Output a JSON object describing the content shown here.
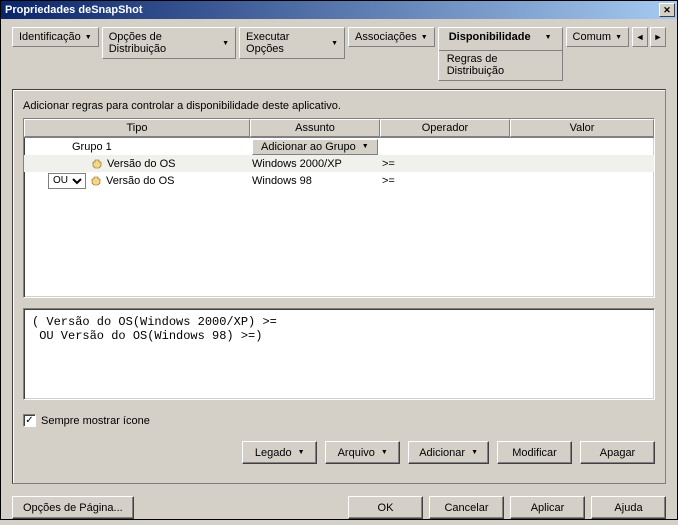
{
  "title": "Propriedades deSnapShot",
  "tabs": {
    "identificacao": "Identificação",
    "opcoes_dist": "Opções de Distribuição",
    "executar": "Executar Opções",
    "associacoes": "Associações",
    "disponibilidade": "Disponibilidade",
    "disponibilidade_sub": "Regras de Distribuição",
    "comum": "Comum"
  },
  "panel_label": "Adicionar regras para controlar a disponibilidade deste aplicativo.",
  "columns": {
    "tipo": "Tipo",
    "assunto": "Assunto",
    "operador": "Operador",
    "valor": "Valor"
  },
  "group_button": "Adicionar ao Grupo",
  "rows": [
    {
      "tipo": "Grupo 1",
      "assunto_btn": true,
      "kind": "group"
    },
    {
      "tipo": "Versão do OS",
      "assunto": "Windows 2000/XP",
      "operador": ">=",
      "kind": "rule"
    },
    {
      "ou": "OU",
      "tipo": "Versão do OS",
      "assunto": "Windows 98",
      "operador": ">=",
      "kind": "ou"
    }
  ],
  "expression": "( Versão do OS(Windows 2000/XP) >=\n OU Versão do OS(Windows 98) >=)",
  "checkbox_label": "Sempre mostrar ícone",
  "buttons": {
    "legado": "Legado",
    "arquivo": "Arquivo",
    "adicionar": "Adicionar",
    "modificar": "Modificar",
    "apagar": "Apagar",
    "opcoes_pagina": "Opções de Página...",
    "ok": "OK",
    "cancelar": "Cancelar",
    "aplicar": "Aplicar",
    "ajuda": "Ajuda"
  }
}
